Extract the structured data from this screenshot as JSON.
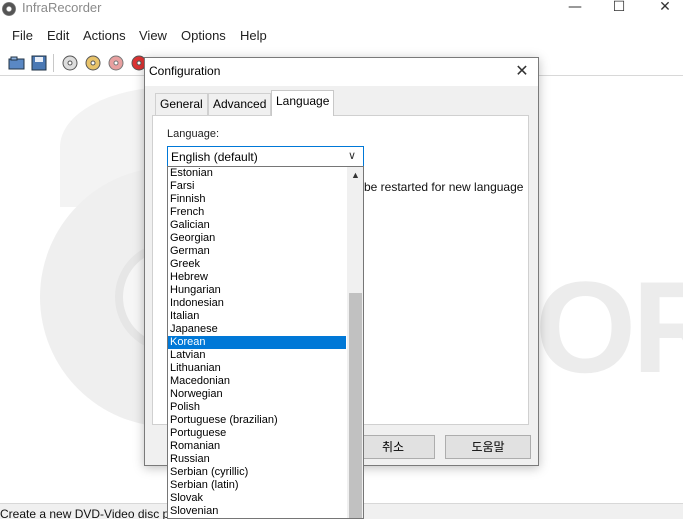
{
  "window": {
    "title": "InfraRecorder",
    "controls": {
      "minimize": "—",
      "maximize": "☐",
      "close": "✕"
    }
  },
  "menu": [
    "File",
    "Edit",
    "Actions",
    "View",
    "Options",
    "Help"
  ],
  "toolbar": {
    "buttons": [
      "open-icon",
      "save-icon",
      "disc-icon",
      "disc-copy-icon",
      "disc-erase-icon",
      "disc-burn-icon"
    ]
  },
  "logo_text": "OR",
  "status": {
    "text": "Create a new DVD-Video disc p"
  },
  "dialog": {
    "title": "Configuration",
    "close": "✕",
    "tabs": [
      "General",
      "Advanced",
      "Language"
    ],
    "active_tab": "Language",
    "language_label": "Language:",
    "language_value": "English (default)",
    "note": "be restarted for new language",
    "buttons": {
      "cancel": "취소",
      "help": "도움말"
    }
  },
  "language_list": {
    "items": [
      "Estonian",
      "Farsi",
      "Finnish",
      "French",
      "Galician",
      "Georgian",
      "German",
      "Greek",
      "Hebrew",
      "Hungarian",
      "Indonesian",
      "Italian",
      "Japanese",
      "Korean",
      "Latvian",
      "Lithuanian",
      "Macedonian",
      "Norwegian",
      "Polish",
      "Portuguese (brazilian)",
      "Portuguese",
      "Romanian",
      "Russian",
      "Serbian (cyrillic)",
      "Serbian (latin)",
      "Slovak",
      "Slovenian"
    ],
    "selected": "Korean",
    "scroll_up": "▲",
    "select_arrow": "∨"
  },
  "colors": {
    "selection": "#0078d7",
    "focus_border": "#0078d7"
  }
}
